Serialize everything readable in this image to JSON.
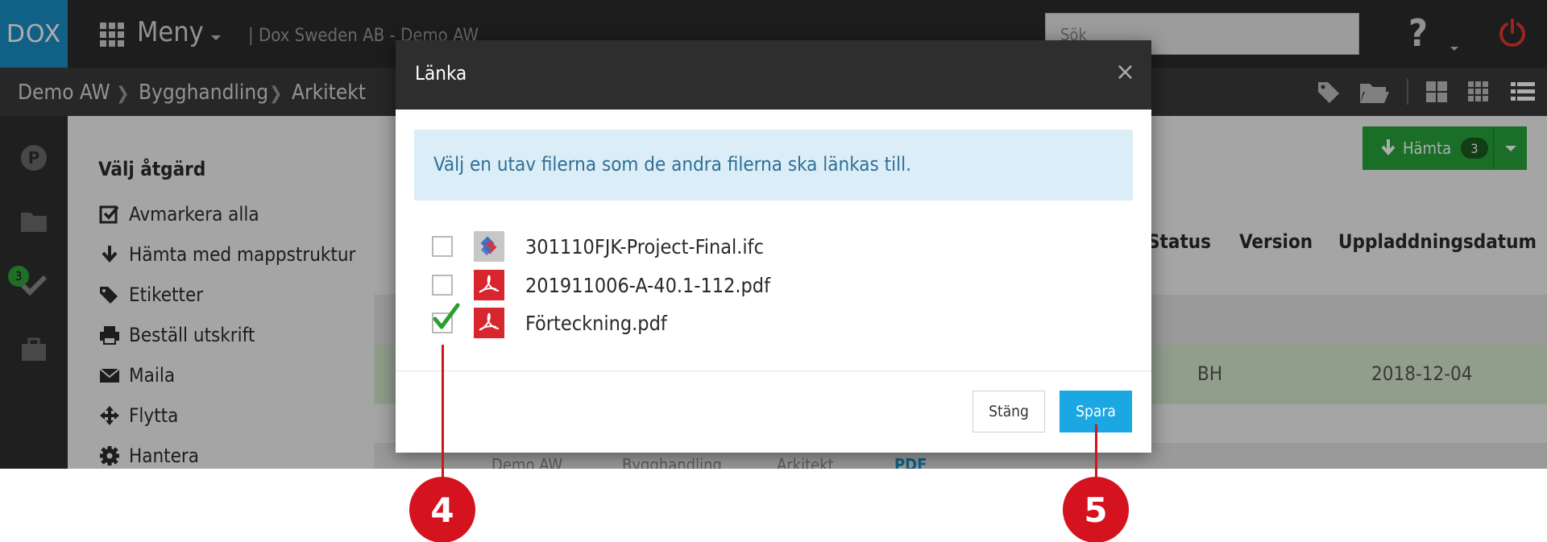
{
  "app": {
    "logo": "DOX",
    "menu_label": "Meny",
    "company": "| Dox Sweden AB - Demo AW",
    "search_placeholder": "Sök",
    "help": "?"
  },
  "breadcrumb": [
    "Demo AW",
    "Bygghandling",
    "Arkitekt"
  ],
  "sidebar": {
    "badge_count": "3"
  },
  "actions": {
    "title": "Välj åtgärd",
    "items": [
      "Avmarkera alla",
      "Hämta med mappstruktur",
      "Etiketter",
      "Beställ utskrift",
      "Maila",
      "Flytta",
      "Hantera"
    ]
  },
  "main": {
    "download_label": "Hämta",
    "download_count": "3",
    "columns": [
      "Status",
      "Version",
      "Uppladdningsdatum"
    ],
    "row": {
      "version": "BH",
      "date": "2018-12-04"
    },
    "path": [
      "Demo AW",
      "Bygghandling",
      "Arkitekt",
      "PDF"
    ]
  },
  "modal": {
    "title": "Länka",
    "close": "×",
    "info": "Välj en utav filerna som de andra filerna ska länkas till.",
    "files": [
      {
        "name": "301110FJK-Project-Final.ifc",
        "checked": false,
        "icon": "ifc-file-icon"
      },
      {
        "name": "201911006-A-40.1-112.pdf",
        "checked": false,
        "icon": "pdf-file-icon"
      },
      {
        "name": "Förteckning.pdf",
        "checked": true,
        "icon": "pdf-file-icon"
      }
    ],
    "close_button": "Stäng",
    "save_button": "Spara"
  },
  "callouts": [
    "4",
    "5"
  ],
  "colors": {
    "accent": "#1aa7e2",
    "download_green": "#27a33a",
    "callout_red": "#d4131f",
    "logo_blue": "#1a8ec4"
  }
}
